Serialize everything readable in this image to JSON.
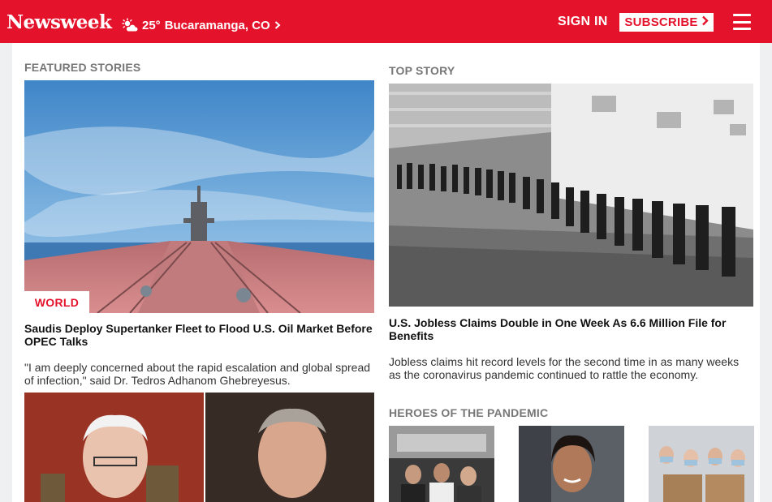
{
  "header": {
    "logo": "Newsweek",
    "weather_icon": "partly-cloudy-icon",
    "temperature": "25°",
    "location": "Bucaramanga, CO",
    "signin_label": "SIGN IN",
    "subscribe_label": "SUBSCRIBE",
    "brand_color": "#e4132b"
  },
  "featured": {
    "section_label": "FEATURED STORIES",
    "story1": {
      "tag": "WORLD",
      "headline": "Saudis Deploy Supertanker Fleet to Flood U.S. Oil Market Before OPEC Talks",
      "dek": "\"I am deeply concerned about the rapid escalation and global spread of infection,\" said Dr. Tedros Adhanom Ghebreyesus."
    }
  },
  "top_story": {
    "section_label": "TOP STORY",
    "headline": "U.S. Jobless Claims Double in One Week As 6.6 Million File for Benefits",
    "dek": "Jobless claims hit record levels for the second time in as many weeks as the coronavirus pandemic continued to rattle the economy."
  },
  "heroes": {
    "section_label": "HEROES OF THE PANDEMIC"
  }
}
